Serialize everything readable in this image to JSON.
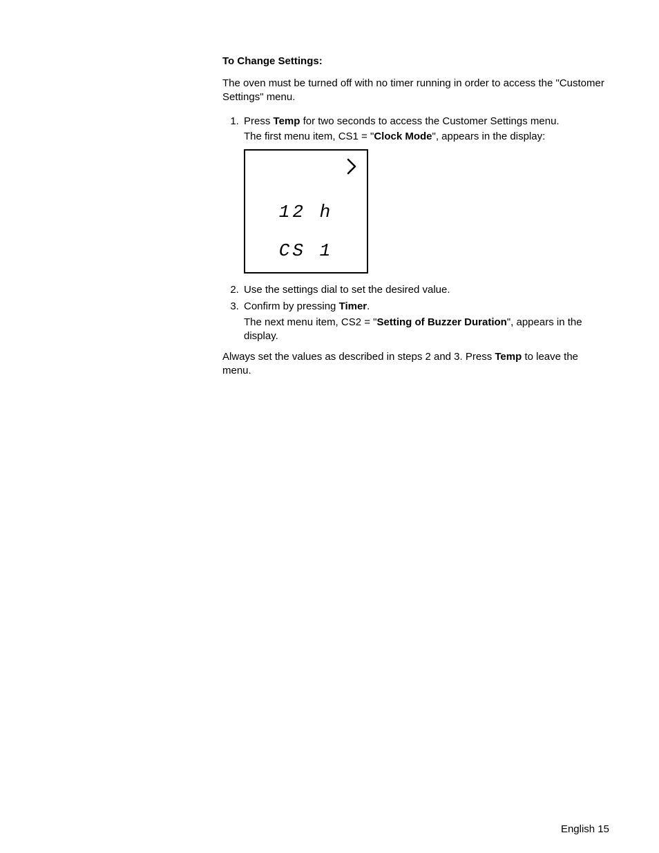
{
  "heading": "To Change Settings:",
  "intro": "The oven must be turned off with no timer running in order to access the \"Customer Settings\" menu.",
  "steps": {
    "s1": {
      "a": "Press ",
      "b": "Temp",
      "c": " for two seconds to access the Customer Settings menu.",
      "line2a": "The first menu item, CS1 = \"",
      "line2b": "Clock Mode",
      "line2c": "\", appears in the display:"
    },
    "s2": "Use the settings dial to set the desired value.",
    "s3": {
      "a": "Confirm by pressing ",
      "b": "Timer",
      "c": ".",
      "line2a": "The next menu item, CS2 = \"",
      "line2b": "Setting of Buzzer Duration",
      "line2c": "\", appears in the display."
    }
  },
  "display": {
    "line1": "12 h",
    "line2": "CS 1"
  },
  "outro_a": "Always set the values as described in steps 2 and 3. Press ",
  "outro_b": "Temp",
  "outro_c": " to leave the menu.",
  "footer": "English 15"
}
